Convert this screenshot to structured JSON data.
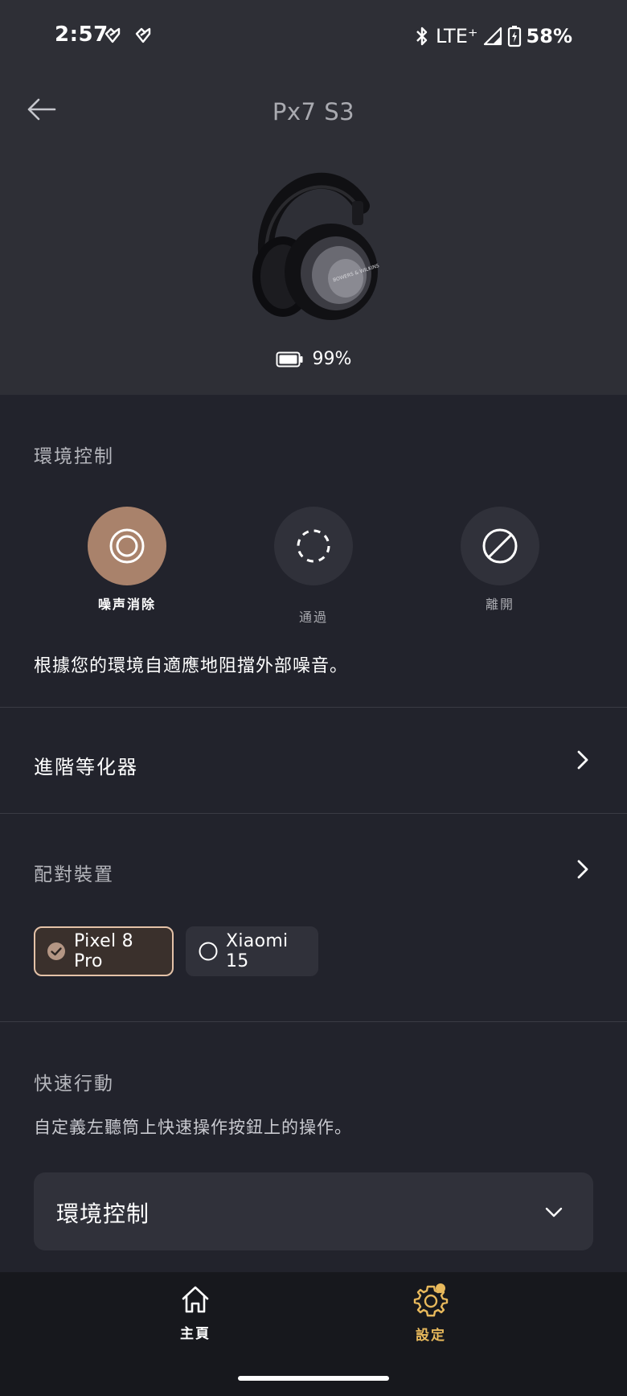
{
  "status_bar": {
    "time": "2:57",
    "network": "LTE⁺",
    "battery": "58%"
  },
  "header": {
    "title": "Px7 S3"
  },
  "device": {
    "battery_level": "99%"
  },
  "ambient_control": {
    "heading": "環境控制",
    "modes": [
      {
        "label": "噪声消除",
        "active": true
      },
      {
        "label": "通過",
        "active": false
      },
      {
        "label": "離開",
        "active": false
      }
    ],
    "description": "根據您的環境自適應地阻擋外部噪音。"
  },
  "advanced_eq": {
    "label": "進階等化器"
  },
  "paired_devices": {
    "heading": "配對裝置",
    "devices": [
      {
        "name": "Pixel 8 Pro",
        "selected": true
      },
      {
        "name": "Xiaomi 15",
        "selected": false
      }
    ]
  },
  "quick_action": {
    "heading": "快速行動",
    "description": "自定義左聽筒上快速操作按鈕上的操作。",
    "selected_option": "環境控制"
  },
  "bottom_nav": {
    "home_label": "主頁",
    "settings_label": "設定"
  },
  "colors": {
    "accent_active": "#a9826b",
    "accent_nav": "#e8b95c",
    "chip_border": "#e4c2a8"
  }
}
